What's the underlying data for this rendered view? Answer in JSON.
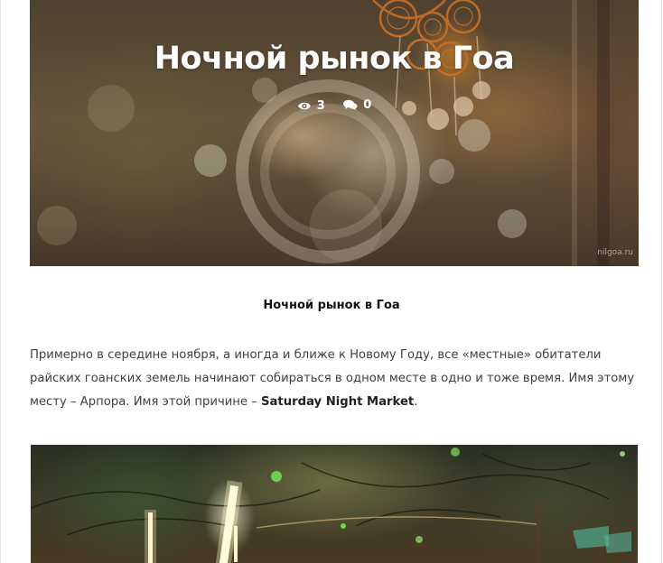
{
  "post": {
    "hero_title": "Ночной рынок в Гоа",
    "views_icon": "eye-icon",
    "views_count": "3",
    "comments_icon": "comments-icon",
    "comments_count": "0",
    "watermark": "nilgoa.ru",
    "subtitle": "Ночной рынок в Гоа",
    "paragraph_text": "Примерно в середине ноября, а иногда и ближе к Новому Году, все «местные» обитатели райских гоанских земель начинают собираться в одном месте в одно и тоже время. Имя этому месту – Арпора. Имя этой причине – ",
    "paragraph_strong": "Saturday Night Market",
    "paragraph_end": "."
  },
  "colors": {
    "title_text": "#ffffff",
    "body_text": "#404040",
    "subtitle_text": "#111111"
  }
}
